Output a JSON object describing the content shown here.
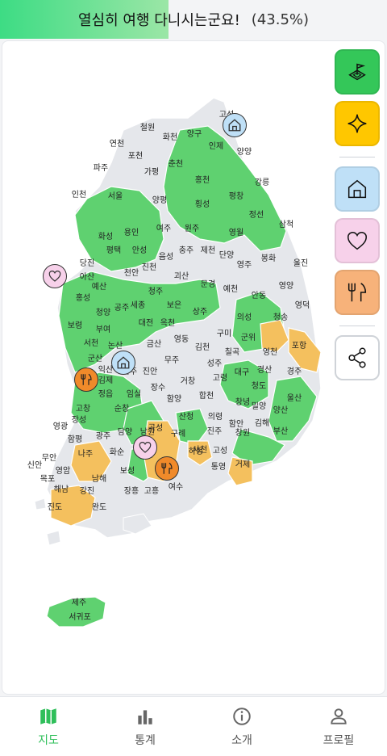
{
  "progress": {
    "message": "열심히 여행 다니시는군요!",
    "percent_text": "(43.5%)",
    "fraction": 0.435,
    "fill_color": "#3ddc84"
  },
  "colors": {
    "visited": "#5fd170",
    "food": "#f4c05e",
    "unvisited": "#e5e7eb",
    "border": "#ffffff"
  },
  "toolbar": {
    "items": [
      {
        "name": "land-flag-icon",
        "color": "#34c759"
      },
      {
        "name": "sparkle-icon",
        "color": "#ffc700"
      },
      {
        "name": "home-icon",
        "color": "#bfe0f7"
      },
      {
        "name": "heart-icon",
        "color": "#f7d1ea"
      },
      {
        "name": "food-icon",
        "color": "#f7b27a"
      },
      {
        "name": "share-icon",
        "color": "#ffffff"
      }
    ]
  },
  "map": {
    "regions": [
      {
        "label": "철원"
      },
      {
        "label": "화천"
      },
      {
        "label": "양구"
      },
      {
        "label": "인제"
      },
      {
        "label": "고성"
      },
      {
        "label": "양양"
      },
      {
        "label": "연천"
      },
      {
        "label": "포천"
      },
      {
        "label": "파주"
      },
      {
        "label": "가평"
      },
      {
        "label": "춘천"
      },
      {
        "label": "홍천"
      },
      {
        "label": "강릉"
      },
      {
        "label": "인천"
      },
      {
        "label": "서울"
      },
      {
        "label": "양평"
      },
      {
        "label": "횡성"
      },
      {
        "label": "평창"
      },
      {
        "label": "정선"
      },
      {
        "label": "화성"
      },
      {
        "label": "용인"
      },
      {
        "label": "여주"
      },
      {
        "label": "원주"
      },
      {
        "label": "영월"
      },
      {
        "label": "삼척"
      },
      {
        "label": "평택"
      },
      {
        "label": "안성"
      },
      {
        "label": "충주"
      },
      {
        "label": "제천"
      },
      {
        "label": "단양"
      },
      {
        "label": "봉화"
      },
      {
        "label": "울진"
      },
      {
        "label": "당진"
      },
      {
        "label": "서산"
      },
      {
        "label": "아산"
      },
      {
        "label": "천안"
      },
      {
        "label": "진천"
      },
      {
        "label": "음성"
      },
      {
        "label": "영주"
      },
      {
        "label": "예산"
      },
      {
        "label": "홍성"
      },
      {
        "label": "청주"
      },
      {
        "label": "괴산"
      },
      {
        "label": "문경"
      },
      {
        "label": "예천"
      },
      {
        "label": "안동"
      },
      {
        "label": "영양"
      },
      {
        "label": "청양"
      },
      {
        "label": "공주"
      },
      {
        "label": "세종"
      },
      {
        "label": "보은"
      },
      {
        "label": "상주"
      },
      {
        "label": "의성"
      },
      {
        "label": "청송"
      },
      {
        "label": "영덕"
      },
      {
        "label": "보령"
      },
      {
        "label": "부여"
      },
      {
        "label": "대전"
      },
      {
        "label": "옥천"
      },
      {
        "label": "구미"
      },
      {
        "label": "군위"
      },
      {
        "label": "포항"
      },
      {
        "label": "서천"
      },
      {
        "label": "논산"
      },
      {
        "label": "금산"
      },
      {
        "label": "영동"
      },
      {
        "label": "김천"
      },
      {
        "label": "칠곡"
      },
      {
        "label": "영천"
      },
      {
        "label": "경주"
      },
      {
        "label": "군산"
      },
      {
        "label": "익산"
      },
      {
        "label": "김제"
      },
      {
        "label": "완주"
      },
      {
        "label": "진안"
      },
      {
        "label": "무주"
      },
      {
        "label": "성주"
      },
      {
        "label": "대구"
      },
      {
        "label": "경산"
      },
      {
        "label": "청도"
      },
      {
        "label": "울산"
      },
      {
        "label": "정읍"
      },
      {
        "label": "임실"
      },
      {
        "label": "장수"
      },
      {
        "label": "거창"
      },
      {
        "label": "고령"
      },
      {
        "label": "합천"
      },
      {
        "label": "창녕"
      },
      {
        "label": "밀양"
      },
      {
        "label": "양산"
      },
      {
        "label": "고창"
      },
      {
        "label": "순창"
      },
      {
        "label": "남원"
      },
      {
        "label": "함양"
      },
      {
        "label": "산청"
      },
      {
        "label": "의령"
      },
      {
        "label": "함안"
      },
      {
        "label": "창원"
      },
      {
        "label": "김해"
      },
      {
        "label": "부산"
      },
      {
        "label": "영광"
      },
      {
        "label": "장성"
      },
      {
        "label": "담양"
      },
      {
        "label": "곡성"
      },
      {
        "label": "구례"
      },
      {
        "label": "하동"
      },
      {
        "label": "진주"
      },
      {
        "label": "함평"
      },
      {
        "label": "광주"
      },
      {
        "label": "화순"
      },
      {
        "label": "순천"
      },
      {
        "label": "광양"
      },
      {
        "label": "사천"
      },
      {
        "label": "고성"
      },
      {
        "label": "통영"
      },
      {
        "label": "거제"
      },
      {
        "label": "무안"
      },
      {
        "label": "나주"
      },
      {
        "label": "보성"
      },
      {
        "label": "여수"
      },
      {
        "label": "남해"
      },
      {
        "label": "영암"
      },
      {
        "label": "장흥"
      },
      {
        "label": "강진"
      },
      {
        "label": "해남"
      },
      {
        "label": "고흥"
      },
      {
        "label": "진도"
      },
      {
        "label": "신안"
      },
      {
        "label": "완도"
      },
      {
        "label": "목포"
      },
      {
        "label": "제주"
      },
      {
        "label": "서귀포"
      }
    ],
    "markers": [
      {
        "name": "home-marker",
        "type": "home",
        "color": "#bfe0f7"
      },
      {
        "name": "heart-marker",
        "type": "heart",
        "color": "#f7d1ea"
      },
      {
        "name": "food-marker",
        "type": "food",
        "color": "#f08a2a"
      }
    ]
  },
  "bottom_nav": {
    "items": [
      {
        "label": "지도",
        "icon": "map-icon",
        "active": true
      },
      {
        "label": "통계",
        "icon": "bar-chart-icon",
        "active": false
      },
      {
        "label": "소개",
        "icon": "info-icon",
        "active": false
      },
      {
        "label": "프로필",
        "icon": "person-icon",
        "active": false
      }
    ]
  }
}
